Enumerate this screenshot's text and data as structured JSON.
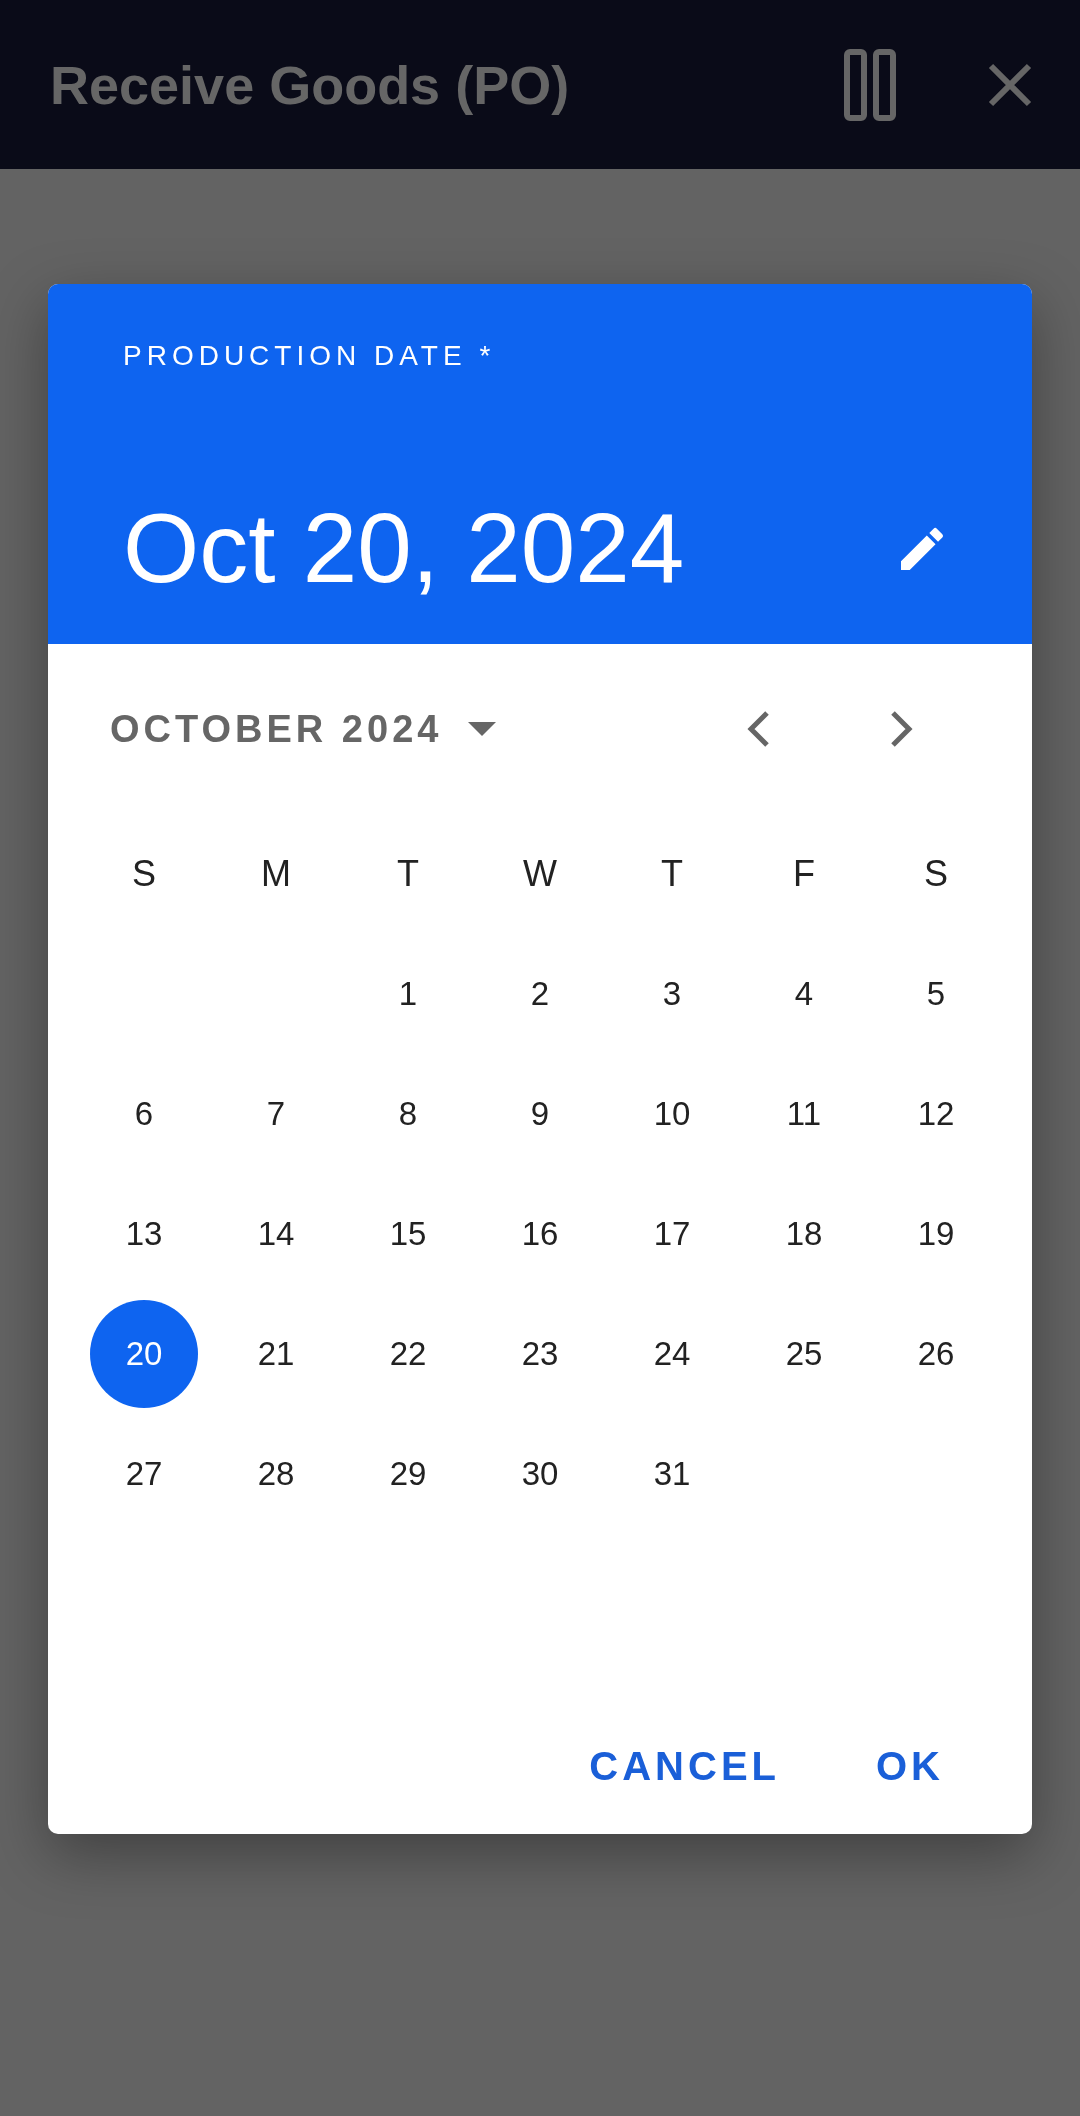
{
  "app_bar": {
    "title": "Receive Goods (PO)"
  },
  "date_picker": {
    "label": "PRODUCTION DATE *",
    "selected_date": "Oct 20, 2024",
    "month": "OCTOBER 2024",
    "weekdays": [
      "S",
      "M",
      "T",
      "W",
      "T",
      "F",
      "S"
    ],
    "weeks": [
      {
        "kind": "leading",
        "days": [
          {
            "label": "1",
            "selected": false
          },
          {
            "label": "2",
            "selected": false
          },
          {
            "label": "3",
            "selected": false
          },
          {
            "label": "4",
            "selected": false
          },
          {
            "label": "5",
            "selected": false
          }
        ]
      },
      {
        "kind": "full",
        "days": [
          {
            "label": "6",
            "selected": false
          },
          {
            "label": "7",
            "selected": false
          },
          {
            "label": "8",
            "selected": false
          },
          {
            "label": "9",
            "selected": false
          },
          {
            "label": "10",
            "selected": false
          },
          {
            "label": "11",
            "selected": false
          },
          {
            "label": "12",
            "selected": false
          }
        ]
      },
      {
        "kind": "full",
        "days": [
          {
            "label": "13",
            "selected": false
          },
          {
            "label": "14",
            "selected": false
          },
          {
            "label": "15",
            "selected": false
          },
          {
            "label": "16",
            "selected": false
          },
          {
            "label": "17",
            "selected": false
          },
          {
            "label": "18",
            "selected": false
          },
          {
            "label": "19",
            "selected": false
          }
        ]
      },
      {
        "kind": "full",
        "days": [
          {
            "label": "20",
            "selected": true
          },
          {
            "label": "21",
            "selected": false
          },
          {
            "label": "22",
            "selected": false
          },
          {
            "label": "23",
            "selected": false
          },
          {
            "label": "24",
            "selected": false
          },
          {
            "label": "25",
            "selected": false
          },
          {
            "label": "26",
            "selected": false
          }
        ]
      },
      {
        "kind": "trailing",
        "days": [
          {
            "label": "27",
            "selected": false
          },
          {
            "label": "28",
            "selected": false
          },
          {
            "label": "29",
            "selected": false
          },
          {
            "label": "30",
            "selected": false
          },
          {
            "label": "31",
            "selected": false
          }
        ]
      }
    ],
    "buttons": [
      "CANCEL",
      "OK"
    ]
  }
}
